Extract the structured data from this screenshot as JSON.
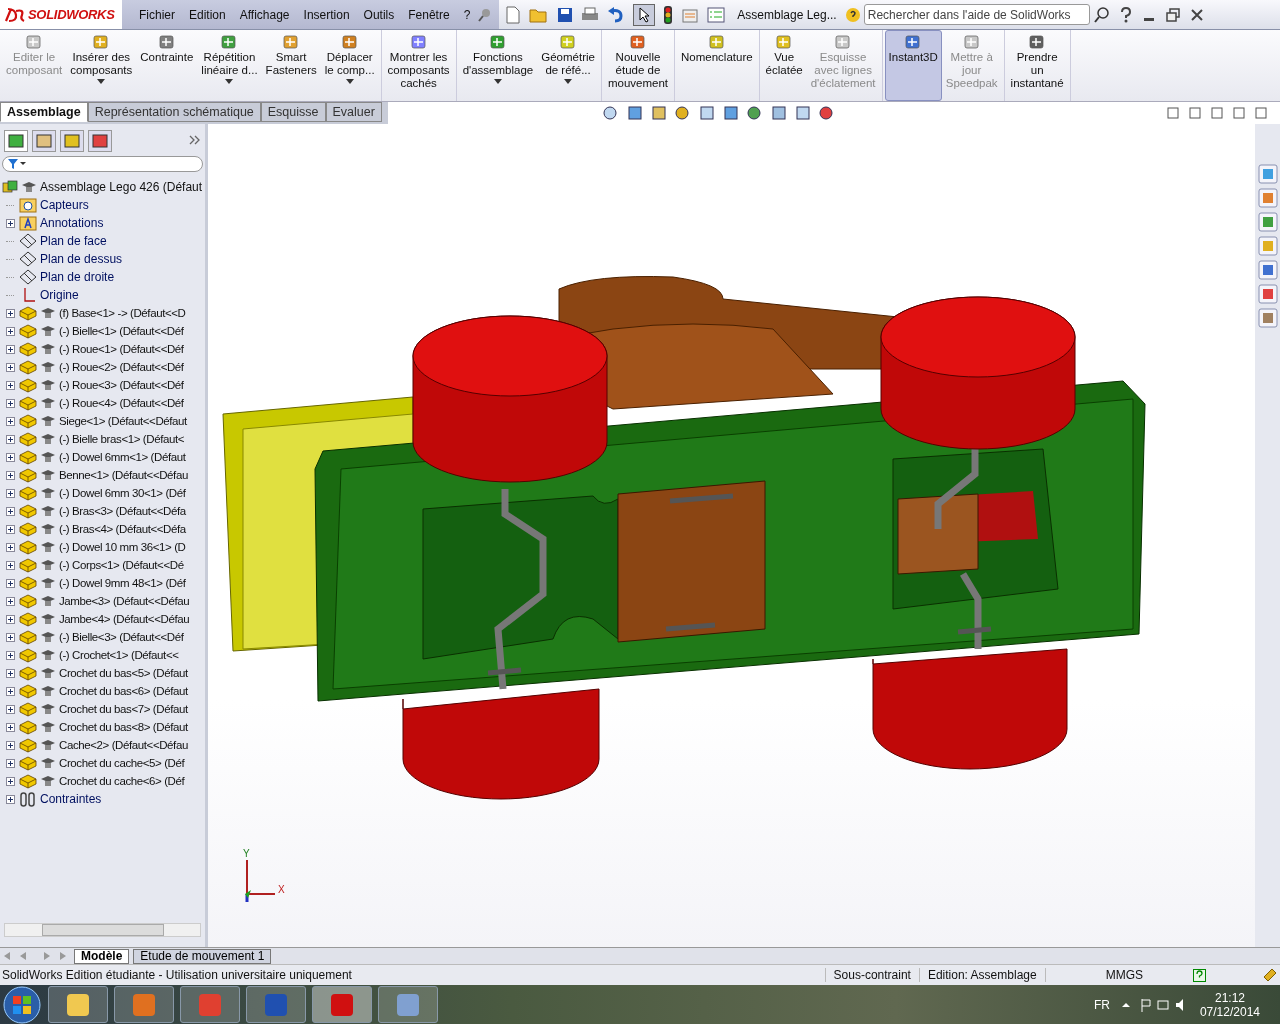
{
  "app": {
    "logo": "SOLIDWORKS",
    "menu": [
      "Fichier",
      "Edition",
      "Affichage",
      "Insertion",
      "Outils",
      "Fenêtre",
      "?"
    ],
    "document_title": "Assemblage Leg...",
    "search": {
      "placeholder": "Rechercher dans l'aide de SolidWorks"
    }
  },
  "ribbon": {
    "groups": [
      [
        {
          "label": "Editer le\ncomposant",
          "disabled": true,
          "selected": false,
          "dropdown": false
        },
        {
          "label": "Insérer des\ncomposants",
          "disabled": false,
          "selected": false,
          "dropdown": true
        },
        {
          "label": "Contrainte",
          "disabled": false,
          "selected": false,
          "dropdown": false
        },
        {
          "label": "Répétition\nlinéaire d...",
          "disabled": false,
          "selected": false,
          "dropdown": true
        },
        {
          "label": "Smart\nFasteners",
          "disabled": false,
          "selected": false,
          "dropdown": false
        },
        {
          "label": "Déplacer\nle comp...",
          "disabled": false,
          "selected": false,
          "dropdown": true
        }
      ],
      [
        {
          "label": "Montrer les\ncomposants\ncachés",
          "disabled": false,
          "selected": false,
          "dropdown": false
        }
      ],
      [
        {
          "label": "Fonctions\nd'assemblage",
          "disabled": false,
          "selected": false,
          "dropdown": true
        },
        {
          "label": "Géométrie\nde réfé...",
          "disabled": false,
          "selected": false,
          "dropdown": true
        }
      ],
      [
        {
          "label": "Nouvelle\nétude de\nmouvement",
          "disabled": false,
          "selected": false,
          "dropdown": false
        }
      ],
      [
        {
          "label": "Nomenclature",
          "disabled": false,
          "selected": false,
          "dropdown": false
        }
      ],
      [
        {
          "label": "Vue\néclatée",
          "disabled": false,
          "selected": false,
          "dropdown": false
        },
        {
          "label": "Esquisse\navec lignes\nd'éclatement",
          "disabled": true,
          "selected": false,
          "dropdown": false
        }
      ],
      [
        {
          "label": "Instant3D",
          "disabled": false,
          "selected": true,
          "dropdown": false
        },
        {
          "label": "Mettre à\njour\nSpeedpak",
          "disabled": true,
          "selected": false,
          "dropdown": false
        }
      ],
      [
        {
          "label": "Prendre\nun\ninstantané",
          "disabled": false,
          "selected": false,
          "dropdown": false
        }
      ]
    ]
  },
  "command_tabs": [
    {
      "label": "Assemblage",
      "selected": true
    },
    {
      "label": "Représentation schématique",
      "selected": false
    },
    {
      "label": "Esquisse",
      "selected": false
    },
    {
      "label": "Evaluer",
      "selected": false
    }
  ],
  "feature_tree": {
    "label": "Assemblage Lego 426  (Défaut",
    "kind": "assembly",
    "children": [
      {
        "label": "Capteurs",
        "kind": "sensor-folder",
        "expandable": false
      },
      {
        "label": "Annotations",
        "kind": "annotation-folder",
        "expandable": true
      },
      {
        "label": "Plan de face",
        "kind": "plane",
        "expandable": false
      },
      {
        "label": "Plan de dessus",
        "kind": "plane",
        "expandable": false
      },
      {
        "label": "Plan de droite",
        "kind": "plane",
        "expandable": false
      },
      {
        "label": "Origine",
        "kind": "origin",
        "expandable": false
      },
      {
        "label": "(f) Base<1> -> (Défaut<<D",
        "kind": "component",
        "expandable": true
      },
      {
        "label": "(-) Bielle<1> (Défaut<<Déf",
        "kind": "component",
        "expandable": true
      },
      {
        "label": "(-) Roue<1> (Défaut<<Déf",
        "kind": "component",
        "expandable": true
      },
      {
        "label": "(-) Roue<2> (Défaut<<Déf",
        "kind": "component",
        "expandable": true
      },
      {
        "label": "(-) Roue<3> (Défaut<<Déf",
        "kind": "component",
        "expandable": true
      },
      {
        "label": "(-) Roue<4> (Défaut<<Déf",
        "kind": "component",
        "expandable": true
      },
      {
        "label": "Siege<1> (Défaut<<Défaut",
        "kind": "component",
        "expandable": true
      },
      {
        "label": "(-) Bielle bras<1> (Défaut<",
        "kind": "component",
        "expandable": true
      },
      {
        "label": "(-) Dowel 6mm<1> (Défaut",
        "kind": "component",
        "expandable": true
      },
      {
        "label": "Benne<1> (Défaut<<Défau",
        "kind": "component",
        "expandable": true
      },
      {
        "label": "(-) Dowel 6mm 30<1> (Déf",
        "kind": "component",
        "expandable": true
      },
      {
        "label": "(-) Bras<3> (Défaut<<Défa",
        "kind": "component",
        "expandable": true
      },
      {
        "label": "(-) Bras<4> (Défaut<<Défa",
        "kind": "component",
        "expandable": true
      },
      {
        "label": "(-) Dowel 10 mm 36<1> (D",
        "kind": "component",
        "expandable": true
      },
      {
        "label": "(-) Corps<1> (Défaut<<Dé",
        "kind": "component",
        "expandable": true
      },
      {
        "label": "(-) Dowel 9mm 48<1> (Déf",
        "kind": "component",
        "expandable": true
      },
      {
        "label": "Jambe<3> (Défaut<<Défau",
        "kind": "component",
        "expandable": true
      },
      {
        "label": "Jambe<4> (Défaut<<Défau",
        "kind": "component",
        "expandable": true
      },
      {
        "label": "(-) Bielle<3> (Défaut<<Déf",
        "kind": "component",
        "expandable": true
      },
      {
        "label": "(-) Crochet<1> (Défaut<<",
        "kind": "component",
        "expandable": true
      },
      {
        "label": "Crochet du bas<5> (Défaut",
        "kind": "component",
        "expandable": true
      },
      {
        "label": "Crochet du bas<6> (Défaut",
        "kind": "component",
        "expandable": true
      },
      {
        "label": "Crochet du bas<7> (Défaut",
        "kind": "component",
        "expandable": true
      },
      {
        "label": "Crochet du bas<8> (Défaut",
        "kind": "component",
        "expandable": true
      },
      {
        "label": "Cache<2> (Défaut<<Défau",
        "kind": "component",
        "expandable": true
      },
      {
        "label": "Crochet du cache<5> (Déf",
        "kind": "component",
        "expandable": true
      },
      {
        "label": "Crochet du cache<6> (Déf",
        "kind": "component",
        "expandable": true
      },
      {
        "label": "Contraintes",
        "kind": "mates",
        "expandable": true
      }
    ]
  },
  "viewport": {
    "triad": {
      "y_label": "Y",
      "x_label": "X"
    }
  },
  "bottom_tabs": [
    {
      "label": "Modèle",
      "selected": true
    },
    {
      "label": "Etude de mouvement 1",
      "selected": false
    }
  ],
  "status_bar": {
    "message": "SolidWorks Edition étudiante - Utilisation universitaire uniquement",
    "constraint": "Sous-contraint",
    "mode": "Edition: Assemblage",
    "units": "MMGS"
  },
  "taskbar": {
    "language": "FR",
    "time": "21:12",
    "date": "07/12/2014"
  }
}
